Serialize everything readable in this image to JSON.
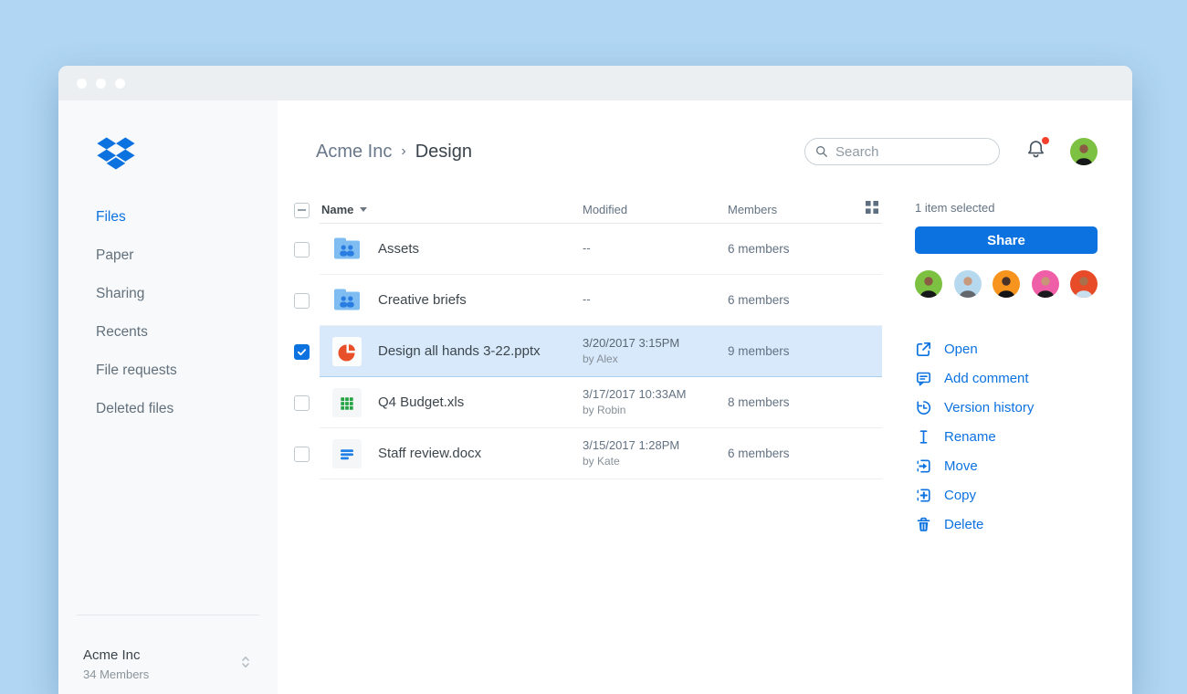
{
  "sidebar": {
    "items": [
      {
        "label": "Files",
        "active": true
      },
      {
        "label": "Paper",
        "active": false
      },
      {
        "label": "Sharing",
        "active": false
      },
      {
        "label": "Recents",
        "active": false
      },
      {
        "label": "File requests",
        "active": false
      },
      {
        "label": "Deleted files",
        "active": false
      }
    ],
    "team": {
      "name": "Acme Inc",
      "members": "34 Members"
    }
  },
  "header": {
    "breadcrumb": {
      "parent": "Acme Inc",
      "separator": "›",
      "current": "Design"
    },
    "search_placeholder": "Search"
  },
  "table": {
    "columns": {
      "name": "Name",
      "modified": "Modified",
      "members": "Members"
    },
    "rows": [
      {
        "name": "Assets",
        "type": "shared-folder",
        "modified": "--",
        "modified_by": "",
        "members": "6 members",
        "checked": false,
        "selected": false
      },
      {
        "name": "Creative briefs",
        "type": "shared-folder",
        "modified": "--",
        "modified_by": "",
        "members": "6 members",
        "checked": false,
        "selected": false
      },
      {
        "name": "Design all hands 3-22.pptx",
        "type": "pptx",
        "modified": "3/20/2017 3:15PM",
        "modified_by": "by Alex",
        "members": "9 members",
        "checked": true,
        "selected": true
      },
      {
        "name": "Q4 Budget.xls",
        "type": "xls",
        "modified": "3/17/2017 10:33AM",
        "modified_by": "by Robin",
        "members": "8 members",
        "checked": false,
        "selected": false
      },
      {
        "name": "Staff review.docx",
        "type": "docx",
        "modified": "3/15/2017 1:28PM",
        "modified_by": "by Kate",
        "members": "6 members",
        "checked": false,
        "selected": false
      }
    ]
  },
  "panel": {
    "selection_status": "1 item selected",
    "share_label": "Share",
    "avatars": [
      {
        "name": "member-avatar-1",
        "bg": "#7dc142",
        "css": "background:#7dc142"
      },
      {
        "name": "member-avatar-2",
        "bg": "#b7d9f0",
        "css": "background:#b7d9f0"
      },
      {
        "name": "member-avatar-3",
        "bg": "#f7941e",
        "css": "background:#f7941e"
      },
      {
        "name": "member-avatar-4",
        "bg": "#ee5fa7",
        "css": "background:#ee5fa7"
      },
      {
        "name": "member-avatar-5",
        "bg": "#e84b27",
        "css": "background:#e84b27"
      }
    ],
    "actions": [
      {
        "label": "Open",
        "icon": "open-icon"
      },
      {
        "label": "Add comment",
        "icon": "comment-icon"
      },
      {
        "label": "Version history",
        "icon": "version-history-icon"
      },
      {
        "label": "Rename",
        "icon": "rename-icon"
      },
      {
        "label": "Move",
        "icon": "move-icon"
      },
      {
        "label": "Copy",
        "icon": "copy-icon"
      },
      {
        "label": "Delete",
        "icon": "trash-icon"
      }
    ]
  },
  "colors": {
    "accent": "#0c72e0",
    "page_background": "#b0d6f3",
    "selection_row_bg": "#d7e9fb",
    "notification_dot": "#f5402c",
    "pptx_icon": "#e8502a",
    "xls_icon": "#26a344",
    "docx_icon": "#2180e8",
    "folder_icon": "#7fbcf2"
  }
}
